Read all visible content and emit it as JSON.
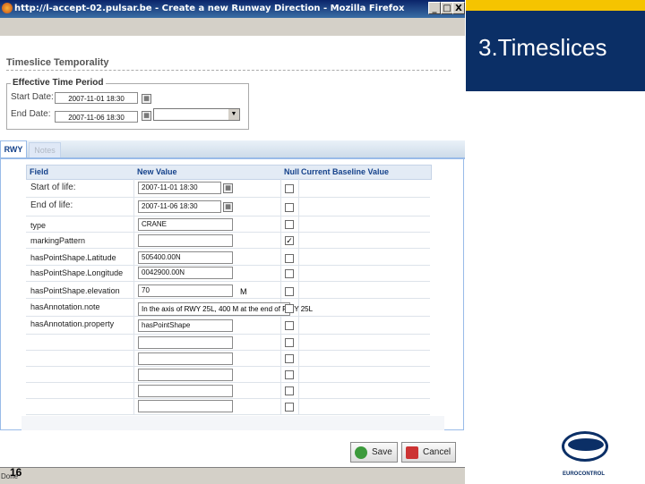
{
  "window": {
    "title": "http://l-accept-02.pulsar.be - Create a new Runway Direction - Mozilla Firefox",
    "controls": [
      "_",
      "□",
      "X"
    ],
    "status": "Done"
  },
  "temporality": {
    "title": "Timeslice Temporality",
    "period_legend": "Effective Time Period",
    "start_label": "Start Date:",
    "start_value": "2007-11-01 18:30",
    "end_label": "End Date:",
    "end_value": "2007-11-06 18:30"
  },
  "tabs": [
    {
      "label": "RWY",
      "active": true
    },
    {
      "label": "Notes",
      "active": false
    }
  ],
  "grid": {
    "headers": {
      "field": "Field",
      "new_value": "New Value",
      "null": "Null",
      "baseline": "Current Baseline Value"
    },
    "rows": [
      {
        "field": "Start of life:",
        "value": "2007-11-01 18:30",
        "null": false
      },
      {
        "field": "End of life:",
        "value": "2007-11-06 18:30",
        "null": false
      },
      {
        "field": "type",
        "value": "CRANE",
        "null": false
      },
      {
        "field": "markingPattern",
        "value": "",
        "null": true
      },
      {
        "field": "hasPointShape.Latitude",
        "value": "505400.00N",
        "null": false
      },
      {
        "field": "hasPointShape.Longitude",
        "value": "0042900.00N",
        "null": false
      },
      {
        "field": "hasPointShape.elevation",
        "value": "70",
        "unit": "M",
        "null": false
      },
      {
        "field": "hasAnnotation.note",
        "value": "In the axis of RWY 25L, 400 M at the end of RWY 25L",
        "null": false
      },
      {
        "field": "hasAnnotation.property",
        "value": "hasPointShape",
        "null": false
      }
    ],
    "null_check_mark": "✓"
  },
  "buttons": {
    "save": "Save",
    "cancel": "Cancel"
  },
  "slide": {
    "title": "3.Timeslices",
    "page_number": "16",
    "logo_text": "EUROCONTROL",
    "colors": {
      "navy": "#0b2f66",
      "yellow": "#f5c400"
    }
  }
}
